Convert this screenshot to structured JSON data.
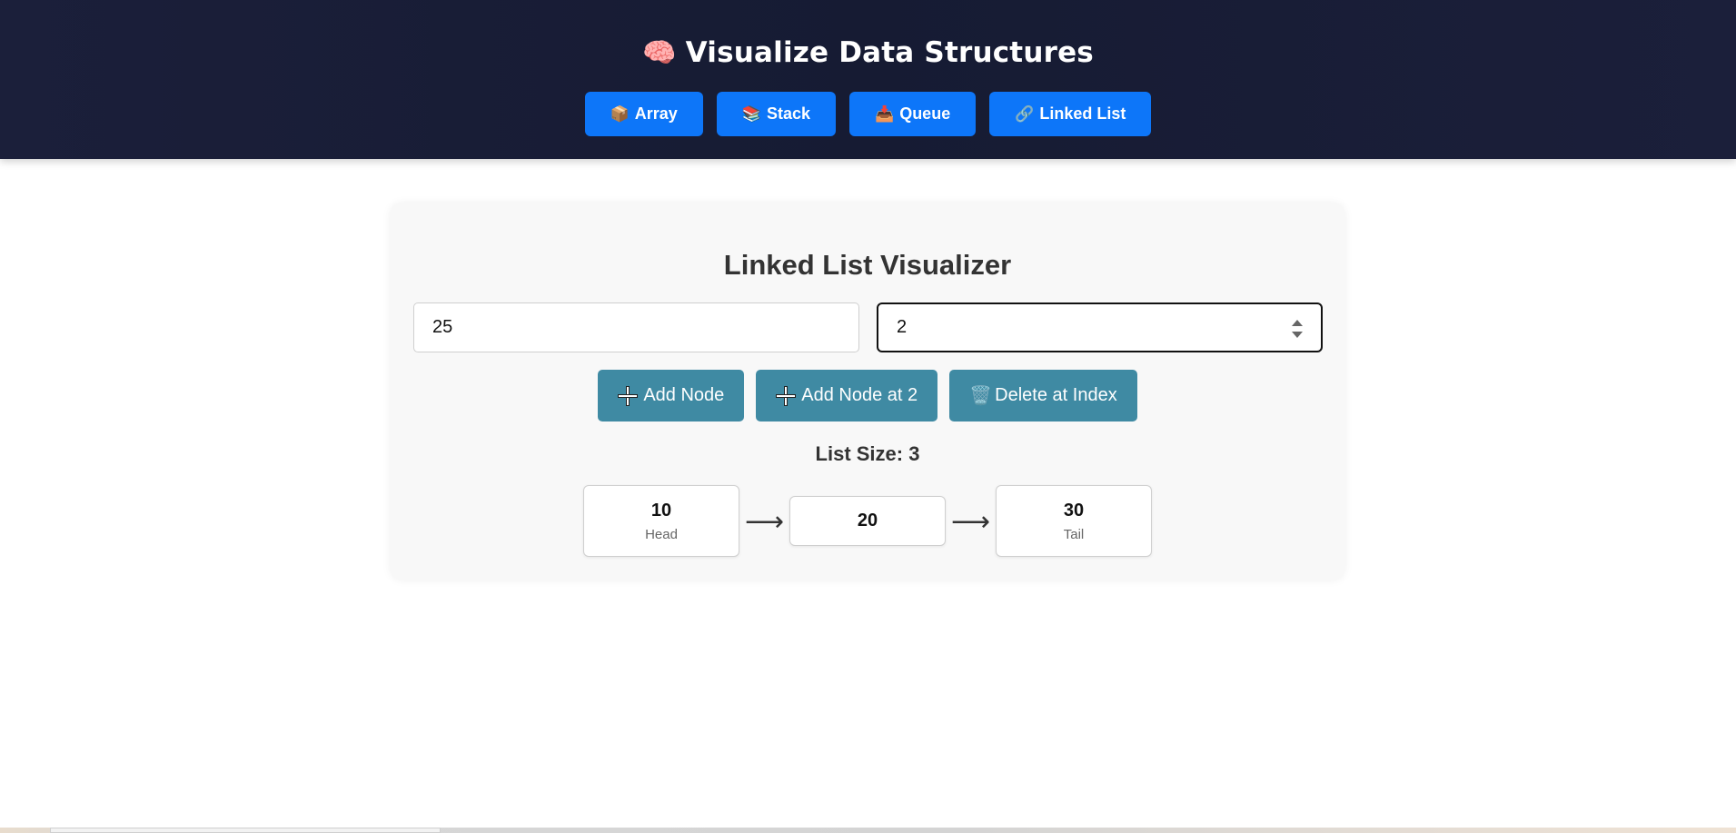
{
  "header": {
    "emoji": "🧠",
    "title": "Visualize Data Structures",
    "nav": [
      {
        "icon": "📦",
        "label": "Array"
      },
      {
        "icon": "📚",
        "label": "Stack"
      },
      {
        "icon": "📥",
        "label": "Queue"
      },
      {
        "icon": "🔗",
        "label": "Linked List"
      }
    ]
  },
  "visualizer": {
    "title": "Linked List Visualizer",
    "value_input": "25",
    "index_input": "2",
    "buttons": {
      "add": "Add Node",
      "add_at": "Add Node at 2",
      "delete": "Delete at Index",
      "delete_icon": "🗑️"
    },
    "list_size": "List Size: 3",
    "arrow": "⟶",
    "nodes": [
      {
        "value": "10",
        "label": "Head"
      },
      {
        "value": "20",
        "label": ""
      },
      {
        "value": "30",
        "label": "Tail"
      }
    ]
  },
  "colors": {
    "header_bg": "#171c35",
    "nav_button": "#0d76f9",
    "action_button": "#3f8aa3",
    "card_bg": "#f8f8f8"
  }
}
